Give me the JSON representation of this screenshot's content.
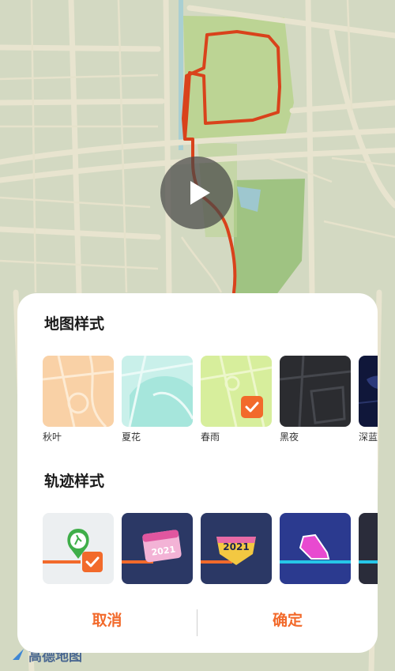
{
  "map_style": {
    "title": "地图样式",
    "options": [
      {
        "label": "秋叶"
      },
      {
        "label": "夏花"
      },
      {
        "label": "春雨",
        "selected": true
      },
      {
        "label": "黑夜"
      },
      {
        "label": "深蓝"
      }
    ]
  },
  "track_style": {
    "title": "轨迹样式",
    "options": [
      {
        "name": "runner",
        "selected": true
      },
      {
        "name": "calendar-2021-badge",
        "text": "2021"
      },
      {
        "name": "ribbon-2021-badge",
        "text": "2021"
      },
      {
        "name": "sneaker-badge"
      },
      {
        "name": "partial-badge"
      }
    ]
  },
  "footer": {
    "cancel_label": "取消",
    "confirm_label": "确定"
  },
  "map_logo": {
    "text": "高德地图"
  },
  "colors": {
    "accent": "#f26a2b",
    "route": "#d9421b"
  },
  "icons": {
    "play": "play-icon",
    "check": "checkmark-icon"
  }
}
